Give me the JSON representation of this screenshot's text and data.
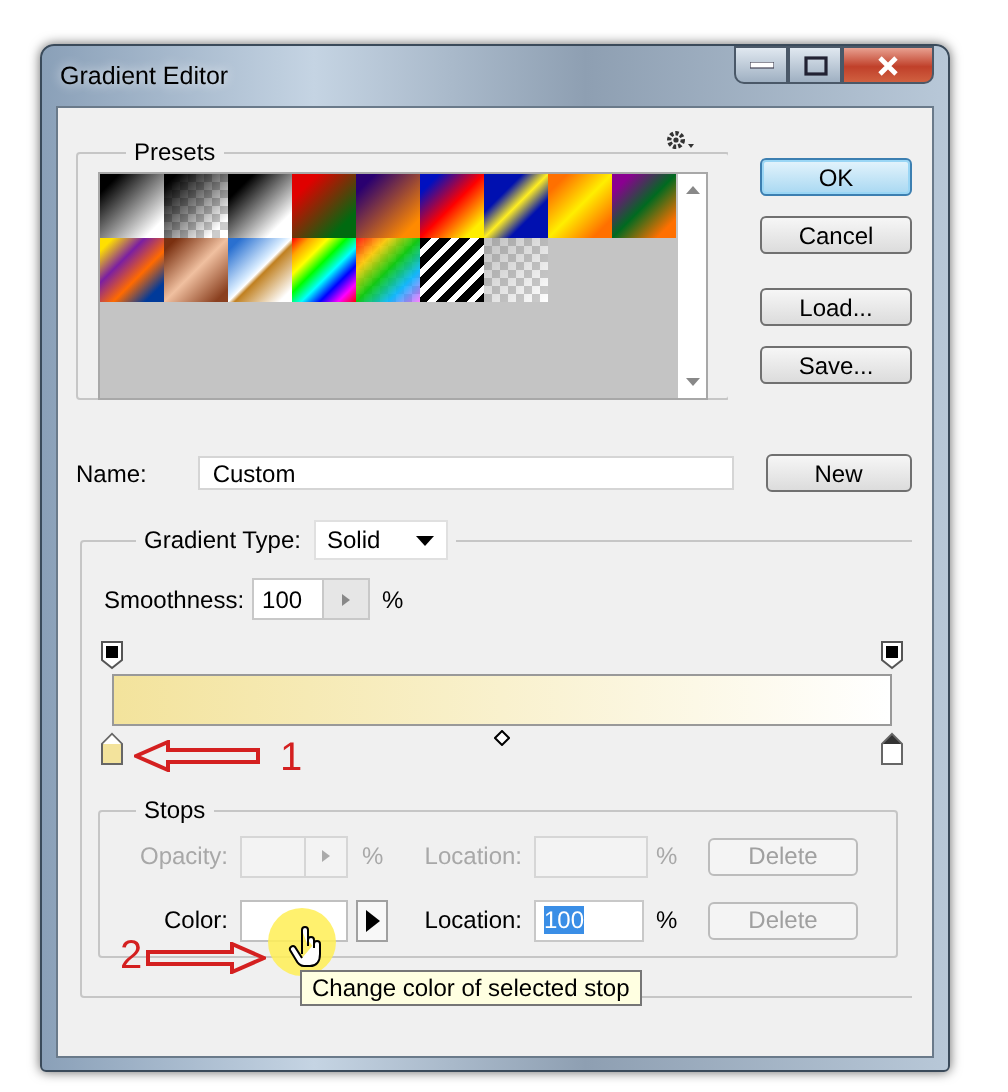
{
  "window": {
    "title": "Gradient Editor"
  },
  "presets": {
    "title": "Presets"
  },
  "buttons": [
    {
      "label": "OK",
      "default": true
    },
    {
      "label": "Cancel",
      "default": false
    },
    {
      "label": "Load...",
      "default": false
    },
    {
      "label": "Save...",
      "default": false
    }
  ],
  "name": {
    "label": "Name:",
    "value": "Custom",
    "button": "New"
  },
  "gradient_type": {
    "label": "Gradient Type:",
    "value": "Solid"
  },
  "smoothness": {
    "label": "Smoothness:",
    "value": "100",
    "unit": "%"
  },
  "opacity_stops": [
    {
      "selected": false
    },
    {
      "selected": false
    }
  ],
  "color_stops": [
    {
      "color": "#f3e39c",
      "selected": false
    },
    {
      "color": "#ffffff",
      "selected": true
    }
  ],
  "stops": {
    "title": "Stops",
    "opacity": {
      "label": "Opacity:",
      "unit": "%",
      "location_label": "Location:",
      "location_unit": "%",
      "delete": "Delete",
      "disabled": true
    },
    "color": {
      "label": "Color:",
      "location_label": "Location:",
      "location": "100",
      "location_unit": "%",
      "delete": "Delete",
      "delete_disabled": true
    }
  },
  "tooltip": "Change color of selected stop",
  "annotations": [
    {
      "label": "1"
    },
    {
      "label": "2"
    }
  ]
}
